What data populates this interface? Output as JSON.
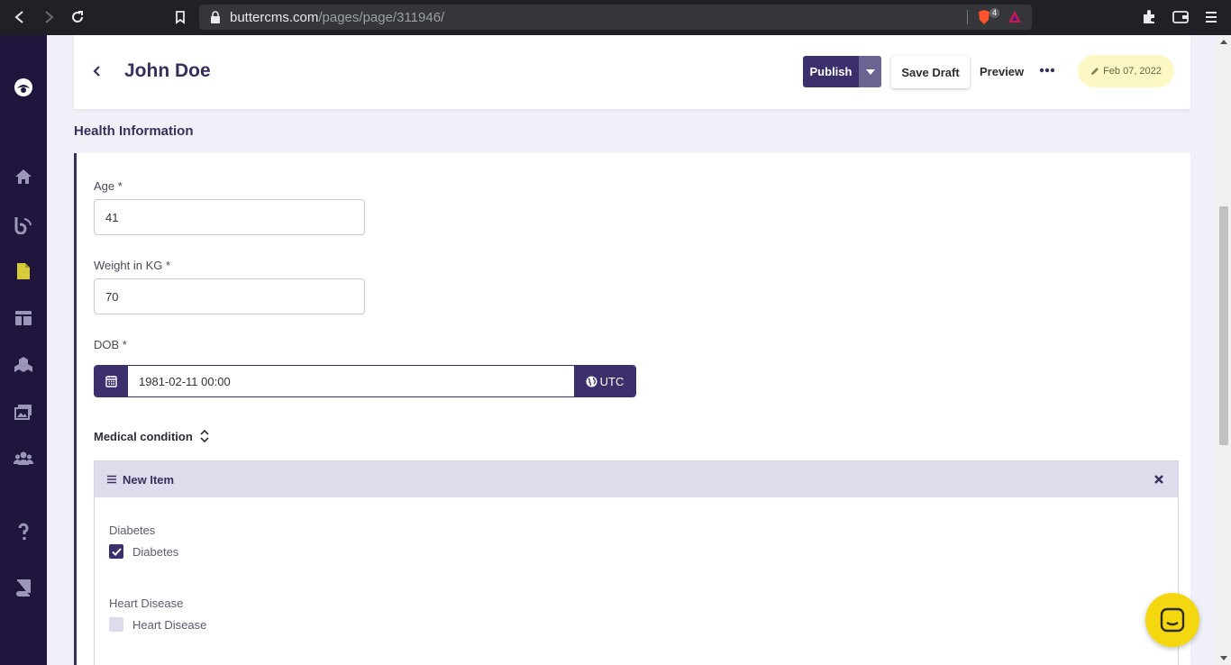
{
  "browser": {
    "url_host": "buttercms.com",
    "url_path": "/pages/page/311946/",
    "shield_count": "4"
  },
  "header": {
    "title": "John Doe",
    "publish_label": "Publish",
    "save_draft_label": "Save Draft",
    "preview_label": "Preview",
    "date": "Feb 07, 2022"
  },
  "section": {
    "title": "Health Information"
  },
  "fields": {
    "age_label": "Age *",
    "age_value": "41",
    "weight_label": "Weight in KG *",
    "weight_value": "70",
    "dob_label": "DOB *",
    "dob_value": "1981-02-11 00:00",
    "timezone": "UTC"
  },
  "repeater": {
    "label": "Medical condition",
    "item_title": "New Item",
    "diabetes_label": "Diabetes",
    "diabetes_option": "Diabetes",
    "diabetes_checked": true,
    "heart_label": "Heart Disease",
    "heart_option": "Heart Disease",
    "heart_checked": false
  },
  "colors": {
    "primary": "#3d2f6b",
    "sidebar": "#20153c",
    "accent_yellow": "#f5d70f",
    "active_nav": "#d6cc3a"
  }
}
